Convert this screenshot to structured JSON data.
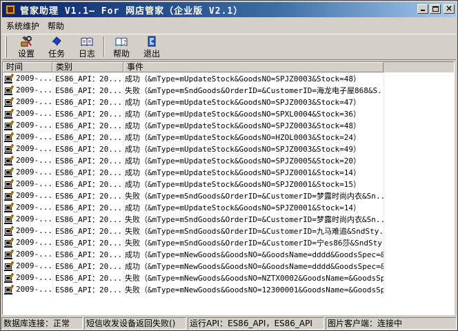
{
  "window": {
    "title": "管家助理 V1.1— For 网店管家（企业版 V2.1）"
  },
  "menu": [
    {
      "label": "系统维护"
    },
    {
      "label": "帮助"
    }
  ],
  "toolbar": [
    {
      "label": "设置",
      "icon": "settings-icon"
    },
    {
      "label": "任务",
      "icon": "task-icon"
    },
    {
      "label": "日志",
      "icon": "log-icon"
    },
    {
      "label": "帮助",
      "icon": "help-icon"
    },
    {
      "label": "退出",
      "icon": "exit-icon"
    }
  ],
  "list": {
    "columns": [
      "时间",
      "类别",
      "事件"
    ],
    "rows": [
      {
        "time": "2009-...",
        "category": "ES86_API：20...",
        "event": "成功（&mType=mUpdateStock&GoodsNO=SPJZ0003&Stock=48）"
      },
      {
        "time": "2009-...",
        "category": "ES86_API：20...",
        "event": "失败（&mType=mSndGoods&OrderID=&CustomerID=海龙电子屋868&S..."
      },
      {
        "time": "2009-...",
        "category": "ES86_API：20...",
        "event": "成功（&mType=mUpdateStock&GoodsNO=SPJZ0003&Stock=47）"
      },
      {
        "time": "2009-...",
        "category": "ES86_API：20...",
        "event": "成功（&mType=mUpdateStock&GoodsNO=SPXL0004&Stock=36）"
      },
      {
        "time": "2009-...",
        "category": "ES86_API：20...",
        "event": "成功（&mType=mUpdateStock&GoodsNO=SPJZ0003&Stock=48）"
      },
      {
        "time": "2009-...",
        "category": "ES86_API：20...",
        "event": "成功（&mType=mUpdateStock&GoodsNO=HZOL0003&Stock=24）"
      },
      {
        "time": "2009-...",
        "category": "ES86_API：20...",
        "event": "成功（&mType=mUpdateStock&GoodsNO=SPJZ0003&Stock=49）"
      },
      {
        "time": "2009-...",
        "category": "ES86_API：20...",
        "event": "成功（&mType=mUpdateStock&GoodsNO=SPJZ0005&Stock=20）"
      },
      {
        "time": "2009-...",
        "category": "ES86_API：20...",
        "event": "成功（&mType=mUpdateStock&GoodsNO=SPJZ0001&Stock=14）"
      },
      {
        "time": "2009-...",
        "category": "ES86_API：20...",
        "event": "成功（&mType=mUpdateStock&GoodsNO=SPJZ0001&Stock=15）"
      },
      {
        "time": "2009-...",
        "category": "ES86_API：20...",
        "event": "失败（&mType=mSndGoods&OrderID=&CustomerID=梦露时尚内衣&Sn..."
      },
      {
        "time": "2009-...",
        "category": "ES86_API：20...",
        "event": "成功（&mType=mUpdateStock&GoodsNO=SPJZ0001&Stock=14）"
      },
      {
        "time": "2009-...",
        "category": "ES86_API：20...",
        "event": "失败（&mType=mSndGoods&OrderID=&CustomerID=梦露时尚内衣&Sn..."
      },
      {
        "time": "2009-...",
        "category": "ES86_API：20...",
        "event": "失败（&mType=mSndGoods&OrderID=&CustomerID=九马难追&SndSty..."
      },
      {
        "time": "2009-...",
        "category": "ES86_API：20...",
        "event": "失败（&mType=mSndGoods&OrderID=&CustomerID=宁es86莎&SndSty..."
      },
      {
        "time": "2009-...",
        "category": "ES86_API：20...",
        "event": "成功（&mType=mNewGoods&GoodsNO=&GoodsName=dddd&GoodsSpec=&..."
      },
      {
        "time": "2009-...",
        "category": "ES86_API：20...",
        "event": "成功（&mType=mNewGoods&GoodsNO=&GoodsName=dddd&GoodsSpec=&..."
      },
      {
        "time": "2009-...",
        "category": "ES86_API：20...",
        "event": "失败（&mType=mNewGoods&GoodsNO=NZTX0002&GoodsName=&GoodsSp..."
      },
      {
        "time": "2009-...",
        "category": "ES86_API：20...",
        "event": "失败（&mType=mNewGoods&GoodsNO=12300001&GoodsName=&GoodsSp..."
      }
    ]
  },
  "status": [
    {
      "text": "数据库连接：正常"
    },
    {
      "text": "短信收发设备返回失败()"
    },
    {
      "text": "运行API：ES86_API，ES86_API"
    },
    {
      "text": "图片客户端：连接中"
    }
  ]
}
